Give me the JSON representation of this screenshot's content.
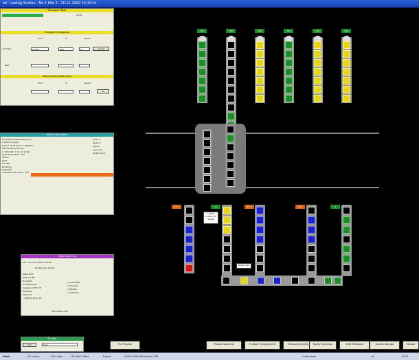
{
  "window": {
    "title": "tel - Lading Station - No 1 Elle 3 - 20.12.2000 15:30:41"
  },
  "transport_panel": {
    "header": "Transport Mode",
    "left_value": "",
    "right_value": "AUTO",
    "section1": "Transport in progress",
    "col_from": "From",
    "col_to": "To",
    "col_bench": "Bench",
    "row1_label": "Lot 5 Ng",
    "row1_from": "92756",
    "row1_to": "486",
    "row1_bench": "4",
    "cancel_btn": "Cancel",
    "row2_label": "Rest",
    "section2": "Manual command entry",
    "ok_btn": "OK"
  },
  "pallet_panel": {
    "header": "Pallet Information",
    "left_rows": [
      "No 3  Batch  00000000_03_10",
      "T  1000 15         Ladle",
      "Alloy  F 1C1B deme      S-1280min",
      "Size   Rückvoimtorruki",
      "In     2010.08.11  01.10   10.08",
      "Start   2010.08.11  16.0",
      "Article",
      "Heat",
      "Lot data",
      "Bookings",
      "Avgdetail",
      "Available  2010.08.11  12.0"
    ],
    "right_rows": [
      "Anzur   4",
      "Laufe   2",
      "Type   4",
      "Layers   4",
      "Widhte  25.0"
    ]
  },
  "store_panel": {
    "header": "Store Pallet List",
    "row1": "Affr  11   Laufe  1           Bahn   P3A4B",
    "row2": "Bucket type  8           Lase",
    "items": [
      "Pallet Buff",
      "Pressure Bfl",
      "Rundtext",
      "Downtime BK",
      "Sequence FPS T.B",
      "Wiedersk",
      "Check bl",
      "_C99875_0315_16"
    ],
    "right_items": [
      "Laminated",
      "Thunder",
      "Monitor",
      "Unknown"
    ],
    "footer": "Store Pallet Info"
  },
  "login_panel": {
    "header": "ID User",
    "left_btn": "Exit",
    "field": "User"
  },
  "vessel": {
    "label": ""
  },
  "labels": {
    "ready": "Ladde Ladder for empty",
    "pallet_feed": "Pallet Feed"
  },
  "top_tags": [
    "101",
    "102",
    "103",
    "104",
    "105",
    "106"
  ],
  "bottom_tags": [
    "15.1",
    "14",
    "13.7",
    "10.4",
    "8"
  ],
  "bottom_buttons": [
    "Full Prepare",
    "Product selection",
    "Product management",
    "Process overview",
    "Ready Conveyor",
    "Heat Prototype",
    "Bucket Storage",
    "Manual"
  ],
  "taskbar": {
    "start": "Start",
    "items": [
      "00 Lading",
      "Uhr-Lager",
      "SC-Mulk  Cfibre",
      "Export",
      "1007% Pallet Pellebenta PDB"
    ],
    "tray": [
      "Lstemusbar",
      "de",
      "15:30"
    ]
  },
  "colors": {
    "green": "#1e8c2a",
    "yellow": "#e6d61b",
    "blue": "#1b22c8",
    "red": "#c81b1b",
    "orange": "#d8661a"
  }
}
